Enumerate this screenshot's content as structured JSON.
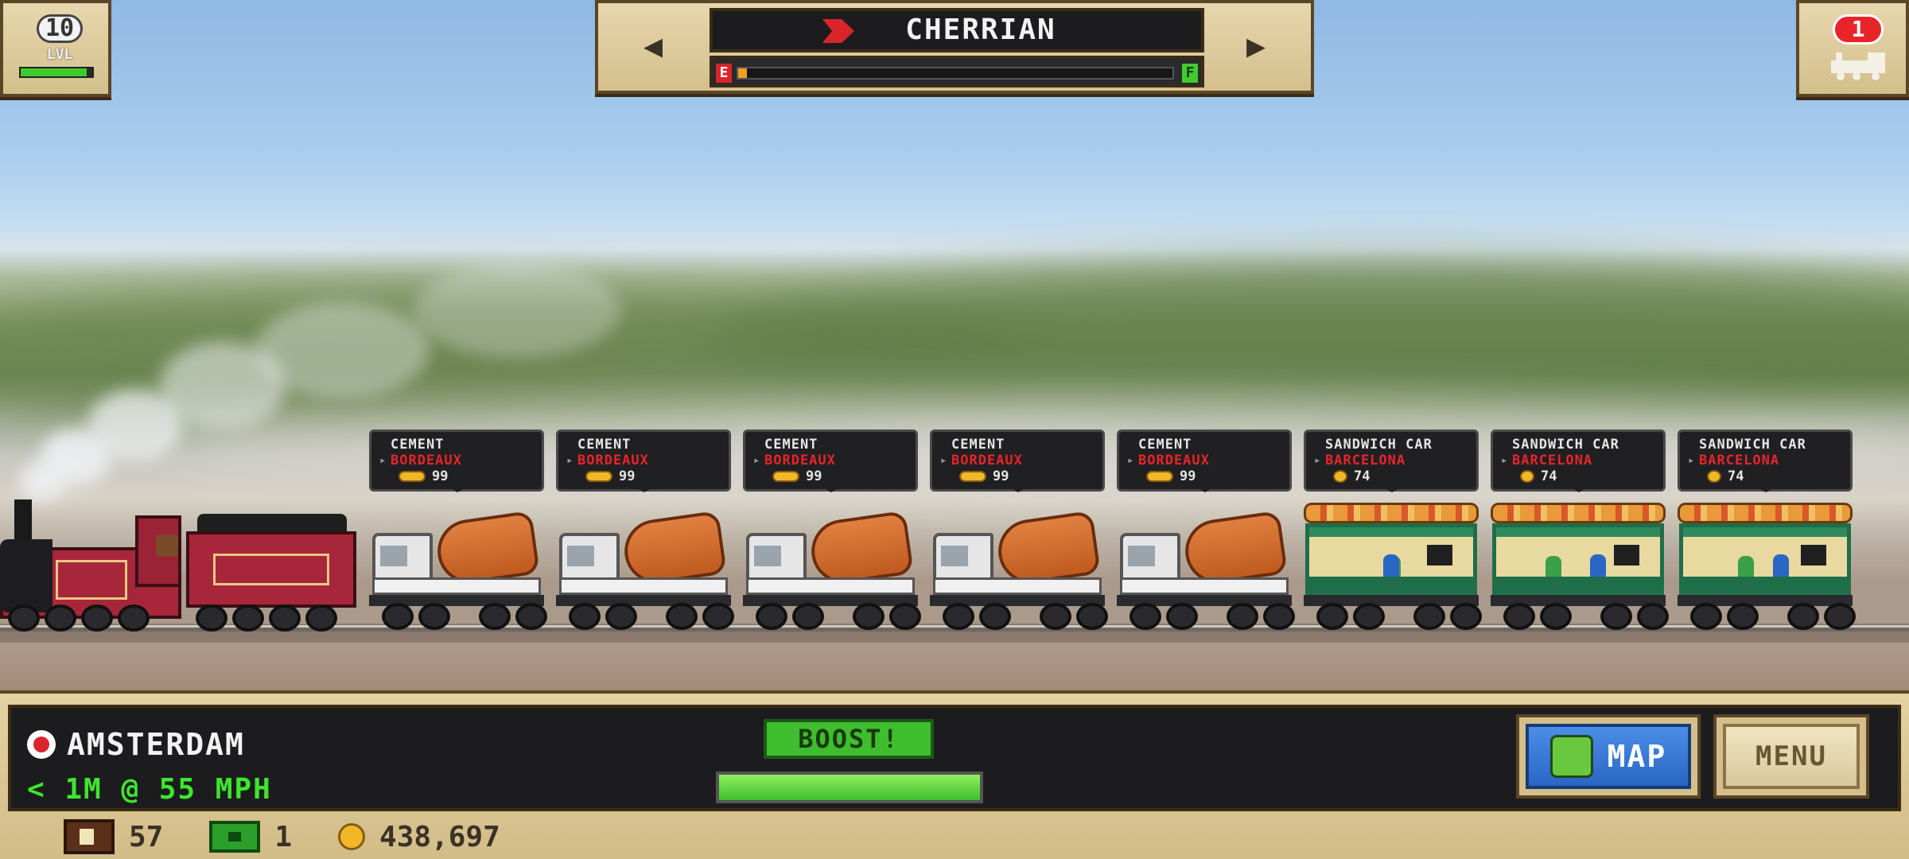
{
  "hud": {
    "level": {
      "number": "10",
      "label": "LVL",
      "xp_fraction": 0.92
    },
    "train_count": "1",
    "train_name": "CHERRIAN",
    "fuel": {
      "empty_label": "E",
      "full_label": "F",
      "fraction": 0.02
    },
    "nav": {
      "prev_glyph": "◀",
      "next_glyph": "▶"
    }
  },
  "cars": [
    {
      "cargo": "CEMENT",
      "destination": "BORDEAUX",
      "value": "99",
      "kind": "cement"
    },
    {
      "cargo": "CEMENT",
      "destination": "BORDEAUX",
      "value": "99",
      "kind": "cement"
    },
    {
      "cargo": "CEMENT",
      "destination": "BORDEAUX",
      "value": "99",
      "kind": "cement"
    },
    {
      "cargo": "CEMENT",
      "destination": "BORDEAUX",
      "value": "99",
      "kind": "cement"
    },
    {
      "cargo": "CEMENT",
      "destination": "BORDEAUX",
      "value": "99",
      "kind": "cement"
    },
    {
      "cargo": "SANDWICH CAR",
      "destination": "BARCELONA",
      "value": "74",
      "kind": "sandwich"
    },
    {
      "cargo": "SANDWICH CAR",
      "destination": "BARCELONA",
      "value": "74",
      "kind": "sandwich"
    },
    {
      "cargo": "SANDWICH CAR",
      "destination": "BARCELONA",
      "value": "74",
      "kind": "sandwich"
    }
  ],
  "bottom": {
    "station": "AMSTERDAM",
    "distance": "< 1M @ 55 MPH",
    "boost_label": "BOOST!",
    "boost_fraction": 1.0,
    "map_label": "MAP",
    "menu_label": "MENU",
    "crates": "57",
    "cash": "1",
    "coins": "438,697"
  },
  "colors": {
    "brand_red": "#a8263a",
    "destination_red": "#e8242a",
    "boost_green": "#3ebe2e",
    "map_blue": "#2a66c4"
  }
}
